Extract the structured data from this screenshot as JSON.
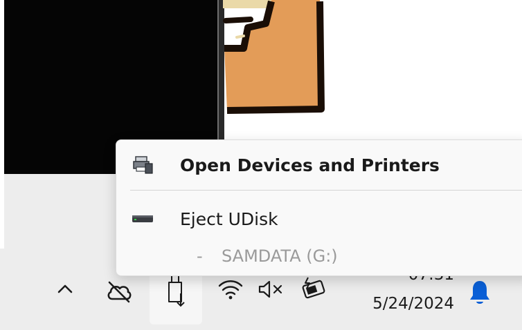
{
  "menu": {
    "items": [
      {
        "label": "Open Devices and Printers",
        "icon": "devices-printers-icon"
      },
      {
        "label": "Eject UDisk",
        "icon": "drive-icon"
      },
      {
        "dash": "-",
        "label": "SAMDATA (G:)"
      }
    ]
  },
  "tray": {
    "icons": [
      "chevron-up-icon",
      "cloud-offline-icon",
      "usb-eject-icon",
      "wifi-icon",
      "volume-muted-icon",
      "battery-charging-icon",
      "notification-bell-icon"
    ]
  },
  "clock": {
    "time": "07:31",
    "date": "5/24/2024"
  },
  "colors": {
    "menu_background": "#f9f9f9",
    "taskbar_background": "#ededed",
    "disabled_text": "#9a9a9a",
    "bell_accent": "#0a5fd6",
    "folder_orange": "#e39c58"
  }
}
